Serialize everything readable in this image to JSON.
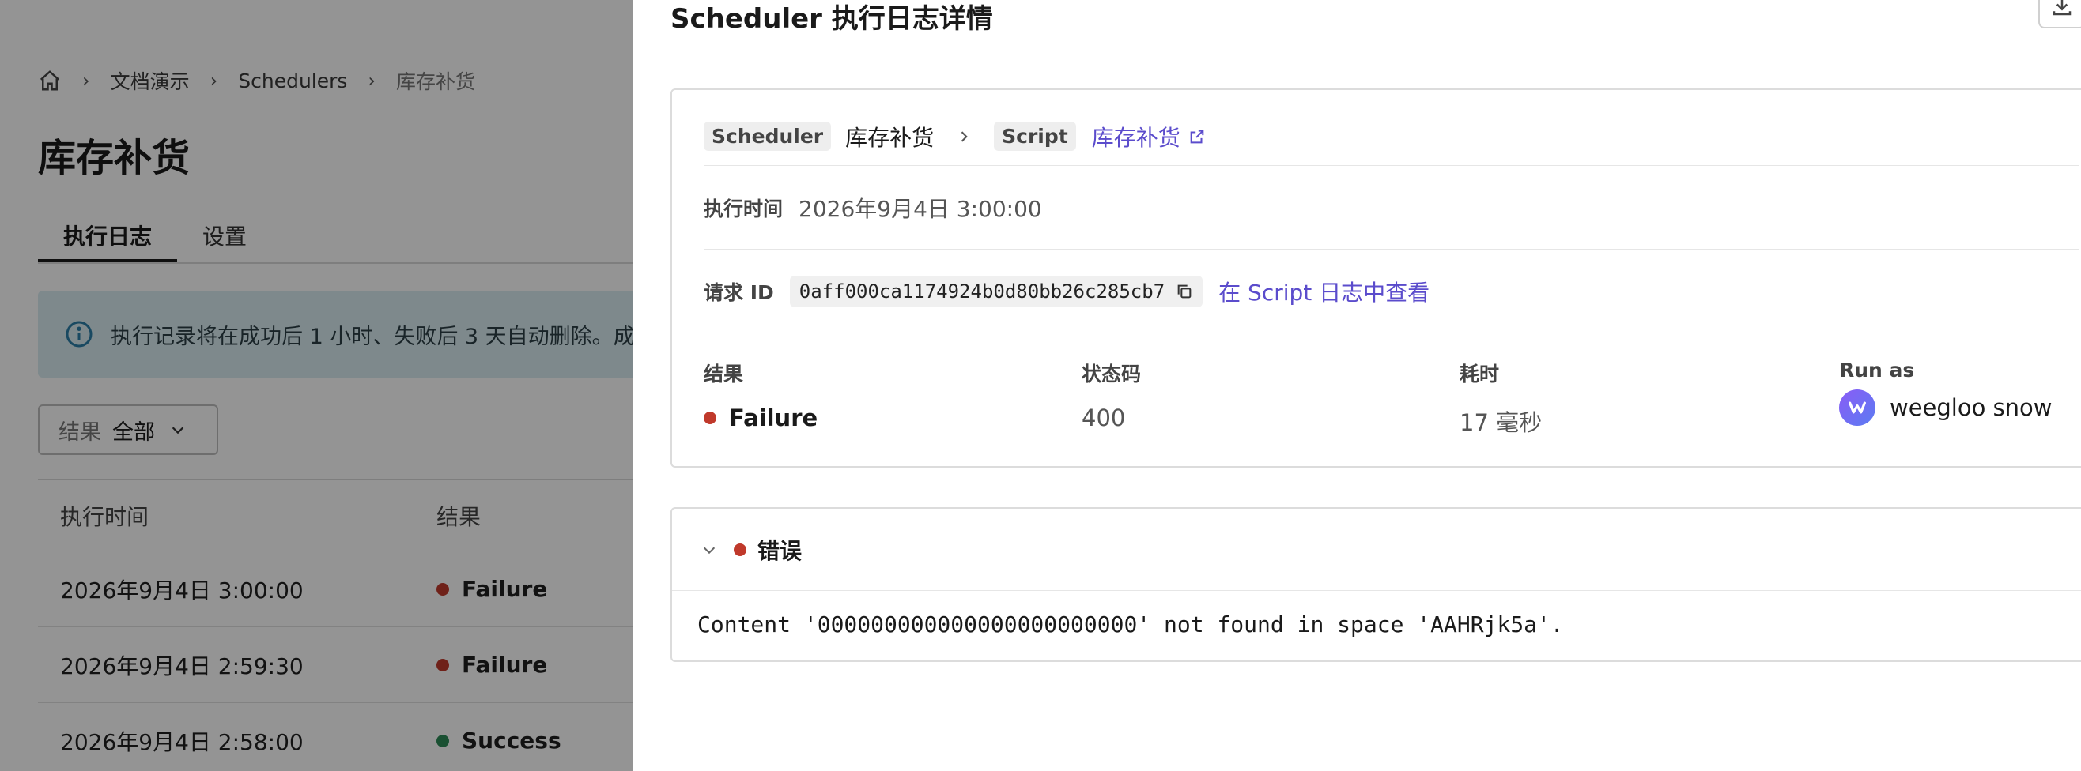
{
  "breadcrumb": {
    "items": [
      "文档演示",
      "Schedulers"
    ],
    "current": "库存补货",
    "separator": "›"
  },
  "page": {
    "title": "库存补货",
    "tabs": [
      {
        "label": "执行日志",
        "active": true
      },
      {
        "label": "设置",
        "active": false
      }
    ],
    "banner": "执行记录将在成功后 1 小时、失败后 3 天自动删除。成",
    "filter": {
      "label": "结果",
      "value": "全部"
    },
    "table": {
      "headers": [
        "执行时间",
        "结果"
      ],
      "rows": [
        {
          "time": "2026年9月4日 3:00:00",
          "result": "Failure"
        },
        {
          "time": "2026年9月4日 2:59:30",
          "result": "Failure"
        },
        {
          "time": "2026年9月4日 2:58:00",
          "result": "Success"
        }
      ]
    }
  },
  "drawer": {
    "title": "Scheduler 执行日志详情",
    "scheduler_tag": "Scheduler",
    "scheduler_name": "库存补货",
    "script_tag": "Script",
    "script_link": "库存补货",
    "exec_time_label": "执行时间",
    "exec_time_value": "2026年9月4日 3:00:00",
    "request_id_label": "请求 ID",
    "request_id_value": "0aff000ca1174924b0d80bb26c285cb7",
    "view_in_script_log": "在 Script 日志中查看",
    "stats": {
      "result_label": "结果",
      "result_value": "Failure",
      "status_label": "状态码",
      "status_value": "400",
      "duration_label": "耗时",
      "duration_value": "17 毫秒",
      "run_as_label": "Run as",
      "run_as_value": "weegloo snow"
    },
    "error": {
      "title": "错误",
      "message": "Content '000000000000000000000000' not found in space 'AAHRjk5a'."
    }
  },
  "colors": {
    "failure": "#c0392b",
    "success": "#2e8b57",
    "link": "#5b4ccc",
    "banner_bg": "#d9ecf2"
  }
}
